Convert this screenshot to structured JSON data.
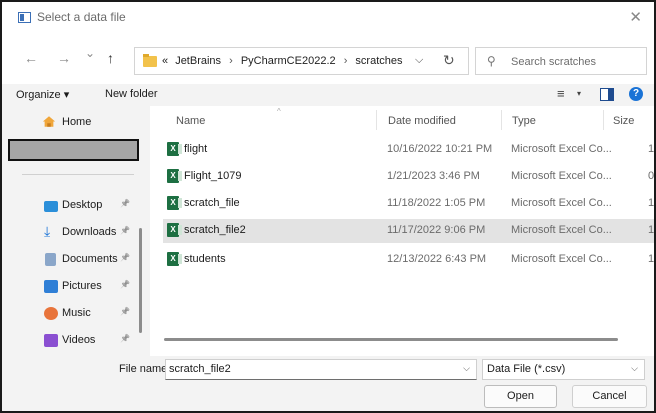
{
  "window": {
    "title": "Select a data file",
    "close_glyph": "✕"
  },
  "nav": {
    "back_glyph": "←",
    "forward_glyph": "→",
    "recent_glyph": "⌄",
    "up_glyph": "↑",
    "breadcrumb": {
      "overflow": "«",
      "items": [
        "JetBrains",
        "PyCharmCE2022.2",
        "scratches"
      ],
      "separator": "›"
    },
    "address_caret": "⌵",
    "refresh_glyph": "↻",
    "search_placeholder": "Search scratches"
  },
  "commands": {
    "organize": "Organize ▾",
    "new_folder": "New folder",
    "view_glyph": "≡",
    "view_caret": "▾",
    "help": "?"
  },
  "sidebar": {
    "items": [
      {
        "label": "Home",
        "icon": "home-icon",
        "pinned": false
      },
      {
        "label": "Desktop",
        "icon": "desktop-icon",
        "pinned": true
      },
      {
        "label": "Downloads",
        "icon": "downloads-icon",
        "pinned": true
      },
      {
        "label": "Documents",
        "icon": "documents-icon",
        "pinned": true
      },
      {
        "label": "Pictures",
        "icon": "pictures-icon",
        "pinned": true
      },
      {
        "label": "Music",
        "icon": "music-icon",
        "pinned": true
      },
      {
        "label": "Videos",
        "icon": "videos-icon",
        "pinned": true
      }
    ],
    "pin_glyph": "📌"
  },
  "filelist": {
    "columns": {
      "name": "Name",
      "date": "Date modified",
      "type": "Type",
      "size": "Size"
    },
    "sort_glyph": "^",
    "files": [
      {
        "name": "flight",
        "date": "10/16/2022 10:21 PM",
        "type": "Microsoft Excel Co...",
        "size": "1",
        "selected": false
      },
      {
        "name": "Flight_1079",
        "date": "1/21/2023 3:46 PM",
        "type": "Microsoft Excel Co...",
        "size": "0",
        "selected": false
      },
      {
        "name": "scratch_file",
        "date": "11/18/2022 1:05 PM",
        "type": "Microsoft Excel Co...",
        "size": "1",
        "selected": false
      },
      {
        "name": "scratch_file2",
        "date": "11/17/2022 9:06 PM",
        "type": "Microsoft Excel Co...",
        "size": "1",
        "selected": true
      },
      {
        "name": "students",
        "date": "12/13/2022 6:43 PM",
        "type": "Microsoft Excel Co...",
        "size": "1",
        "selected": false
      }
    ]
  },
  "footer": {
    "file_name_label": "File name:",
    "file_name_value": "scratch_file2",
    "file_type_value": "Data File (*.csv)",
    "open_label": "Open",
    "cancel_label": "Cancel",
    "caret_glyph": "⌵"
  },
  "colors": {
    "selected_row": "#e3e3e3",
    "excel_green": "#1d6f42",
    "accent_blue": "#1a73d6",
    "folder_yellow": "#f2c24b"
  }
}
